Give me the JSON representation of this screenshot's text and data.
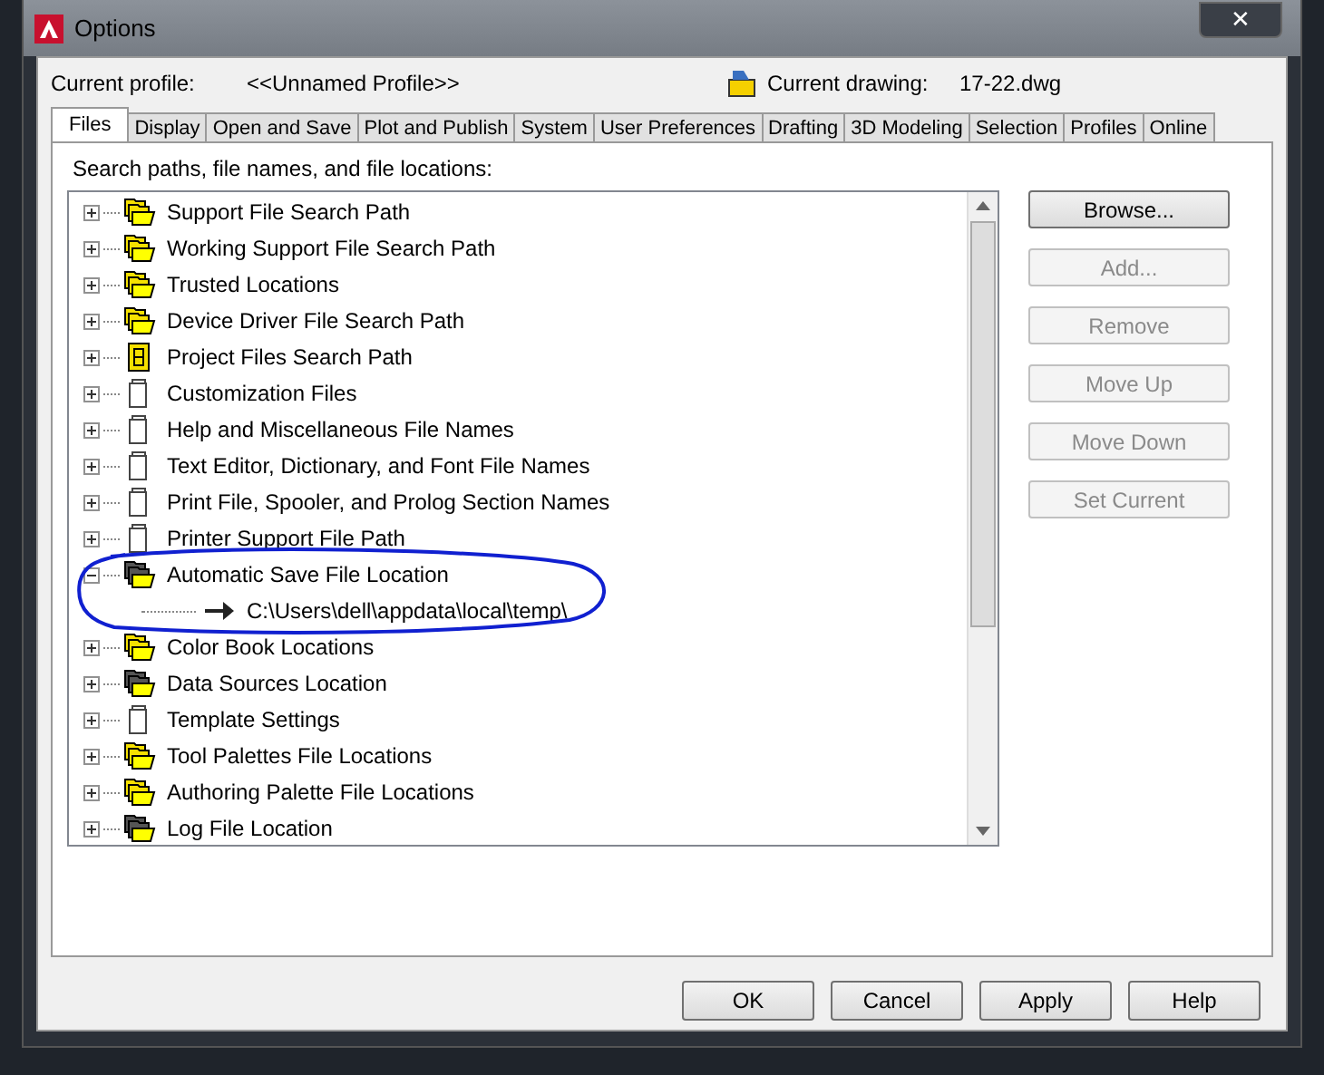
{
  "window": {
    "title": "Options",
    "close": "✕"
  },
  "profile": {
    "label": "Current profile:",
    "value": "<<Unnamed Profile>>"
  },
  "drawing": {
    "label": "Current drawing:",
    "value": "17-22.dwg"
  },
  "tabs": [
    {
      "label": "Files",
      "selected": true
    },
    {
      "label": "Display",
      "selected": false
    },
    {
      "label": "Open and Save",
      "selected": false
    },
    {
      "label": "Plot and Publish",
      "selected": false
    },
    {
      "label": "System",
      "selected": false
    },
    {
      "label": "User Preferences",
      "selected": false
    },
    {
      "label": "Drafting",
      "selected": false
    },
    {
      "label": "3D Modeling",
      "selected": false
    },
    {
      "label": "Selection",
      "selected": false
    },
    {
      "label": "Profiles",
      "selected": false
    },
    {
      "label": "Online",
      "selected": false
    }
  ],
  "tree_label": "Search paths, file names, and file locations:",
  "tree": [
    {
      "label": "Support File Search Path",
      "kind": "folders",
      "expanded": false
    },
    {
      "label": "Working Support File Search Path",
      "kind": "folders",
      "expanded": false
    },
    {
      "label": "Trusted Locations",
      "kind": "folders",
      "expanded": false
    },
    {
      "label": "Device Driver File Search Path",
      "kind": "folders",
      "expanded": false
    },
    {
      "label": "Project Files Search Path",
      "kind": "project",
      "expanded": false
    },
    {
      "label": "Customization Files",
      "kind": "pages",
      "expanded": false
    },
    {
      "label": "Help and Miscellaneous File Names",
      "kind": "pages",
      "expanded": false
    },
    {
      "label": "Text Editor, Dictionary, and Font File Names",
      "kind": "pages",
      "expanded": false
    },
    {
      "label": "Print File, Spooler, and Prolog Section Names",
      "kind": "pages",
      "expanded": false
    },
    {
      "label": "Printer Support File Path",
      "kind": "pages",
      "expanded": false
    },
    {
      "label": "Automatic Save File Location",
      "kind": "dark-folders",
      "expanded": true,
      "children": [
        {
          "label": "C:\\Users\\dell\\appdata\\local\\temp\\",
          "kind": "arrow"
        }
      ]
    },
    {
      "label": "Color Book Locations",
      "kind": "folders",
      "expanded": false
    },
    {
      "label": "Data Sources Location",
      "kind": "dark-folders",
      "expanded": false
    },
    {
      "label": "Template Settings",
      "kind": "pages",
      "expanded": false
    },
    {
      "label": "Tool Palettes File Locations",
      "kind": "folders",
      "expanded": false
    },
    {
      "label": "Authoring Palette File Locations",
      "kind": "folders",
      "expanded": false
    },
    {
      "label": "Log File Location",
      "kind": "dark-folders",
      "expanded": false
    }
  ],
  "side_buttons": [
    {
      "label": "Browse...",
      "disabled": false
    },
    {
      "label": "Add...",
      "disabled": true
    },
    {
      "label": "Remove",
      "disabled": true
    },
    {
      "label": "Move Up",
      "disabled": true
    },
    {
      "label": "Move Down",
      "disabled": true
    },
    {
      "label": "Set Current",
      "disabled": true
    }
  ],
  "buttons": [
    {
      "label": "OK"
    },
    {
      "label": "Cancel"
    },
    {
      "label": "Apply"
    },
    {
      "label": "Help"
    }
  ]
}
